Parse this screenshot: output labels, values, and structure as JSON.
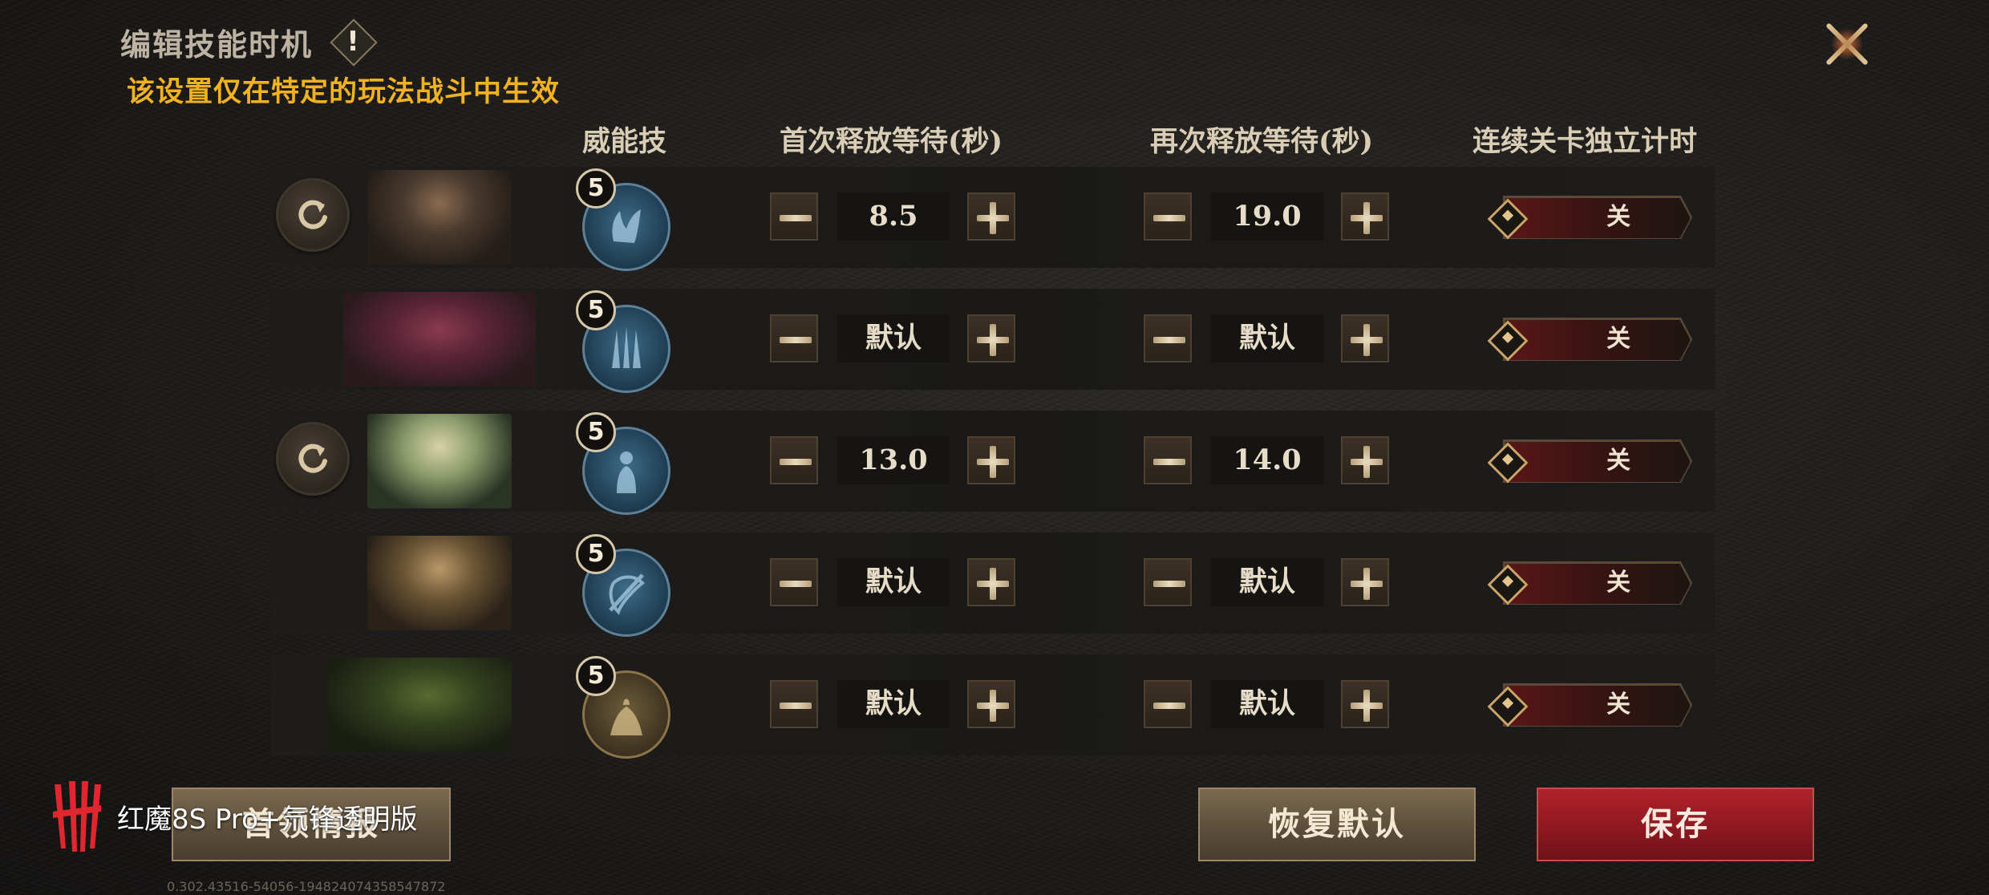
{
  "header": {
    "title": "编辑技能时机",
    "warning_icon": "!",
    "subtitle": "该设置仅在特定的玩法战斗中生效"
  },
  "columns": {
    "skill": "威能技",
    "first_wait": "首次释放等待(秒)",
    "repeat_wait": "再次释放等待(秒)",
    "independent_timer": "连续关卡独立计时"
  },
  "rows": [
    {
      "level": "5",
      "first": "8.5",
      "repeat": "19.0",
      "toggle": "关",
      "has_reset": true,
      "skill_style": "blue"
    },
    {
      "level": "5",
      "first": "默认",
      "repeat": "默认",
      "toggle": "关",
      "has_reset": false,
      "skill_style": "blue"
    },
    {
      "level": "5",
      "first": "13.0",
      "repeat": "14.0",
      "toggle": "关",
      "has_reset": true,
      "skill_style": "blue"
    },
    {
      "level": "5",
      "first": "默认",
      "repeat": "默认",
      "toggle": "关",
      "has_reset": false,
      "skill_style": "blue"
    },
    {
      "level": "5",
      "first": "默认",
      "repeat": "默认",
      "toggle": "关",
      "has_reset": false,
      "skill_style": "gold"
    }
  ],
  "footer": {
    "left_button": "首领情报",
    "restore_button": "恢复默认",
    "save_button": "保存",
    "version": "0.302.43516-54056-19482407435854787​2"
  },
  "watermark": {
    "text": "红魔8S Pro+氘锋透明版",
    "brand_color": "#e0262e"
  },
  "colors": {
    "accent_gold": "#f0b21f",
    "save_red": "#a01c25",
    "skill_blue": "#3d6c88"
  }
}
